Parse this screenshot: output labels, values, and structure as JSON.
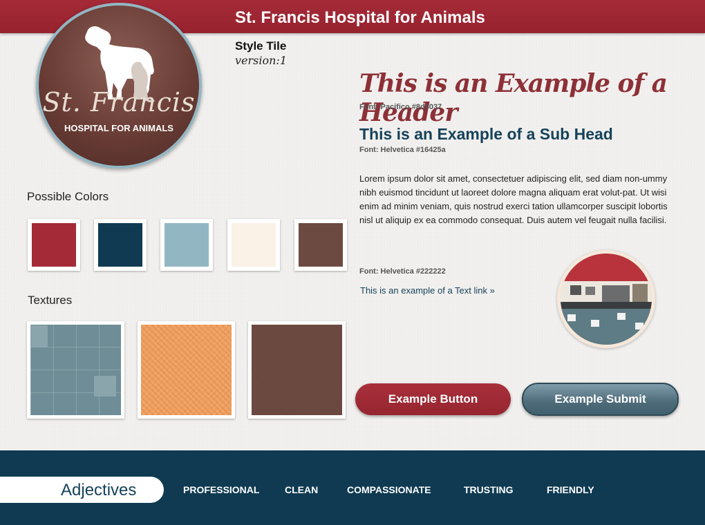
{
  "header": {
    "title": "St. Francis Hospital for Animals"
  },
  "logo": {
    "script": "St. Francis",
    "sub": "HOSPITAL FOR ANIMALS"
  },
  "tile": {
    "title": "Style Tile",
    "version": "version:1"
  },
  "colors": {
    "label": "Possible Colors",
    "swatches": [
      "#a52a37",
      "#0f3a51",
      "#93b6c3",
      "#faf2e6",
      "#6d4a41"
    ]
  },
  "textures": {
    "label": "Textures"
  },
  "typography": {
    "header_text": "This is an Example of a Header",
    "header_note": "Font: Pacifico #8d3037",
    "sub_text": "This is an Example of a Sub Head",
    "sub_note": "Font: Helvetica  #16425a",
    "body_text": "Lorem ipsum dolor sit amet, consectetuer adipiscing elit, sed diam non-ummy nibh euismod tincidunt ut laoreet dolore magna aliquam erat volut-pat. Ut wisi enim ad minim veniam, quis nostrud exerci tation ullamcorper suscipit lobortis nisl ut aliquip ex ea commodo consequat. Duis autem vel feugait nulla facilisi.",
    "body_note": "Font: Helvetica  #222222",
    "link_text": "This is an example of a Text link »"
  },
  "buttons": {
    "primary": "Example Button",
    "submit": "Example Submit"
  },
  "adjectives": {
    "label": "Adjectives",
    "items": [
      "PROFESSIONAL",
      "CLEAN",
      "COMPASSIONATE",
      "TRUSTING",
      "FRIENDLY"
    ]
  }
}
